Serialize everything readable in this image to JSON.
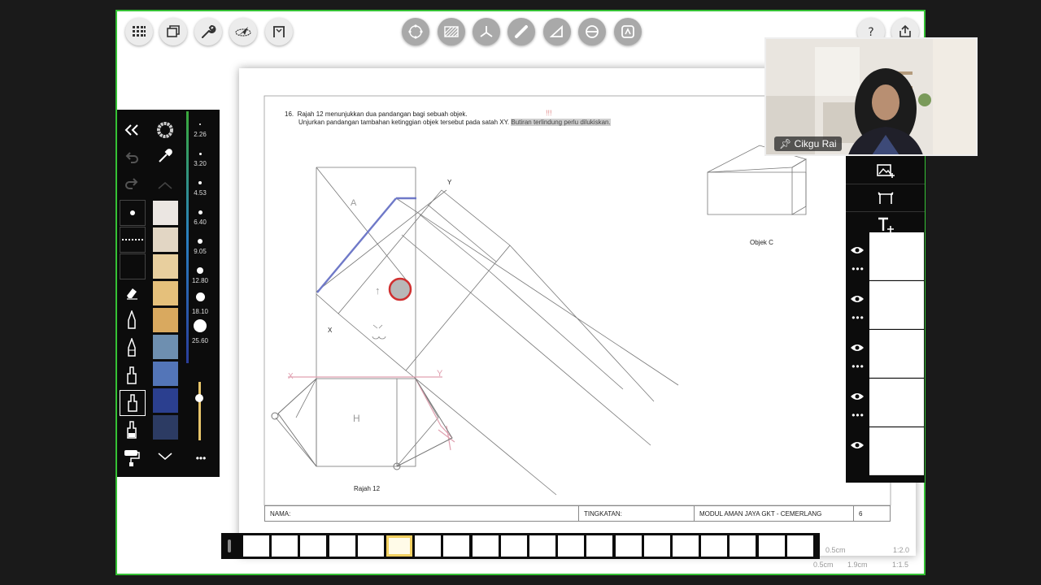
{
  "toolbar_left": [
    {
      "icon": "grid-menu-icon"
    },
    {
      "icon": "pages-icon"
    },
    {
      "icon": "wrench-icon"
    },
    {
      "icon": "laser-pointer-icon"
    },
    {
      "icon": "fit-frame-icon"
    }
  ],
  "toolbar_center": [
    {
      "icon": "shape-recognition-icon"
    },
    {
      "icon": "hatch-pattern-icon"
    },
    {
      "icon": "axis-icon"
    },
    {
      "icon": "ruler-icon"
    },
    {
      "icon": "set-square-icon"
    },
    {
      "icon": "protractor-icon"
    },
    {
      "icon": "stamp-icon"
    }
  ],
  "toolbar_right": [
    {
      "icon": "help-icon"
    },
    {
      "icon": "share-icon"
    }
  ],
  "document": {
    "question_number": "16.",
    "line1": "Rajah 12 menunjukkan dua pandangan bagi sebuah objek.",
    "line2": "Unjurkan pandangan tambahan ketinggian objek tersebut pada satah XY.",
    "line2_highlight": "Butiran terlindung  perlu dilukiskan.",
    "top_mark": "!!!",
    "label_y_top": "Y",
    "label_x_left": "X",
    "label_a": "A",
    "label_h": "H",
    "label_x_hand": "X",
    "label_y_hand": "Y",
    "label_up": "↑",
    "caption_rajah": "Rajah 12",
    "caption_objek": "Objek C",
    "footer_nama": "NAMA:",
    "footer_tingkatan": "TINGKATAN:",
    "footer_modul": "MODUL AMAN JAYA GKT - CEMERLANG",
    "footer_page": "6"
  },
  "left_panel": {
    "collapse_icon": "double-chevron-left-icon",
    "brush_sizes": [
      "2.26",
      "3.20",
      "4.53",
      "6.40",
      "9.05",
      "12.80",
      "18.10",
      "25.60"
    ],
    "swatches": [
      "#ebe6e2",
      "#e2d6c4",
      "#e8cf9e",
      "#e5c07b",
      "#d9a95f",
      "#6e8fb0",
      "#5375b8",
      "#2b3f8f",
      "#2c3b63"
    ],
    "opacity_level": 0.72,
    "more_label": "•••"
  },
  "right_panel": {
    "layers": 5
  },
  "video": {
    "participant_name": "Cikgu Rai"
  },
  "filmstrip": {
    "page_count": 20,
    "selected_index": 5
  },
  "zoom": {
    "row1_left": "0.5cm",
    "row1_right": "1:2.0",
    "row2_a": "0.5cm",
    "row2_b": "1.9cm",
    "row2_c": "1:1.5"
  },
  "colors": {
    "frame_border": "#35c135",
    "panel_bg": "#0c0c0c",
    "cursor_dot": "#b8b8b8",
    "cursor_ring": "#d03030"
  }
}
